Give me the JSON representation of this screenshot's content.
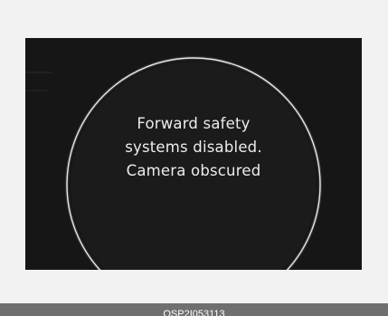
{
  "display": {
    "message_lines": [
      "Forward safety",
      "systems disabled.",
      "Camera obscured"
    ]
  },
  "caption": {
    "code": "OSP2I053113"
  },
  "colors": {
    "page_background": "#f2f2f2",
    "screen_background": "#161616",
    "ring": "#e8e8e8",
    "message_text": "#ececec",
    "caption_bar": "#6f6f6f",
    "caption_text": "#ffffff"
  }
}
